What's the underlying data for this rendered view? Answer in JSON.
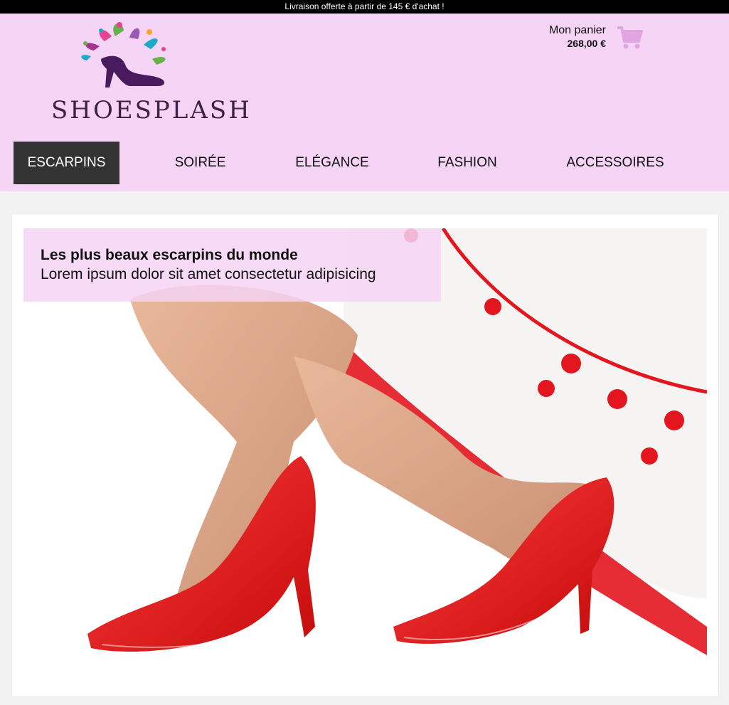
{
  "topbar": {
    "text": "Livraison offerte à partir de 145 € d'achat !"
  },
  "brand": {
    "name": "SHOESPLASH",
    "accent": "#f5d4f5"
  },
  "cart": {
    "label": "Mon panier",
    "total": "268,00 €",
    "icon": "cart-icon",
    "icon_color": "#e0a6e0"
  },
  "nav": {
    "items": [
      {
        "label": "ESCARPINS",
        "active": true
      },
      {
        "label": "SOIRÉE",
        "active": false
      },
      {
        "label": "ELÉGANCE",
        "active": false
      },
      {
        "label": "FASHION",
        "active": false
      },
      {
        "label": "ACCESSOIRES",
        "active": false
      }
    ]
  },
  "hero": {
    "title": "Les plus beaux escarpins du monde",
    "subtitle": "Lorem ipsum dolor sit amet consectetur adipisicing"
  }
}
